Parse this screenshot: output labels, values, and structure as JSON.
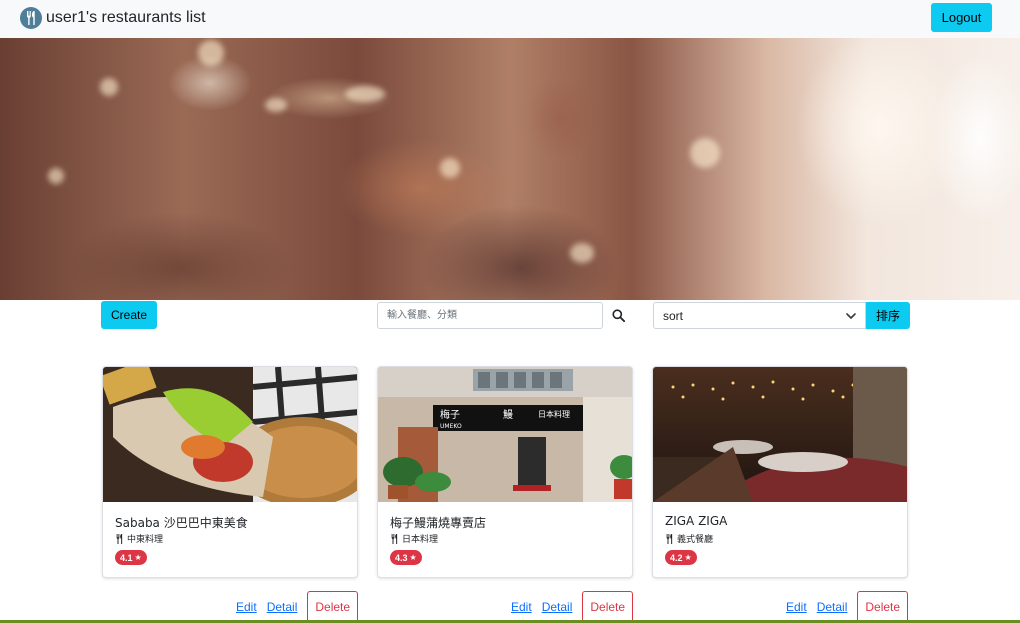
{
  "navbar": {
    "brand_logo_icon": "utensils-icon",
    "title": "user1's restaurants list",
    "logout_label": "Logout"
  },
  "toolbar": {
    "create_label": "Create",
    "search_placeholder": "輸入餐廳、分類",
    "search_icon": "search-icon",
    "sort_value": "sort",
    "sort_button_label": "排序"
  },
  "colors": {
    "accent": "#0dcaf0",
    "danger": "#dc3545",
    "link": "#0d6efd"
  },
  "restaurants": [
    {
      "name": "Sababa 沙巴巴中東美食",
      "category": "中東料理",
      "rating": "4.1",
      "edit_label": "Edit",
      "detail_label": "Detail",
      "delete_label": "Delete"
    },
    {
      "name": "梅子鰻蒲燒專賣店",
      "category": "日本料理",
      "rating": "4.3",
      "edit_label": "Edit",
      "detail_label": "Detail",
      "delete_label": "Delete"
    },
    {
      "name": "ZIGA ZIGA",
      "category": "義式餐廳",
      "rating": "4.2",
      "edit_label": "Edit",
      "detail_label": "Detail",
      "delete_label": "Delete"
    }
  ],
  "sign_texts": {
    "umeko_left": "梅子",
    "umeko_right": "鰻",
    "umeko_en": "UMEKO",
    "umeko_shop": "日本料理"
  }
}
